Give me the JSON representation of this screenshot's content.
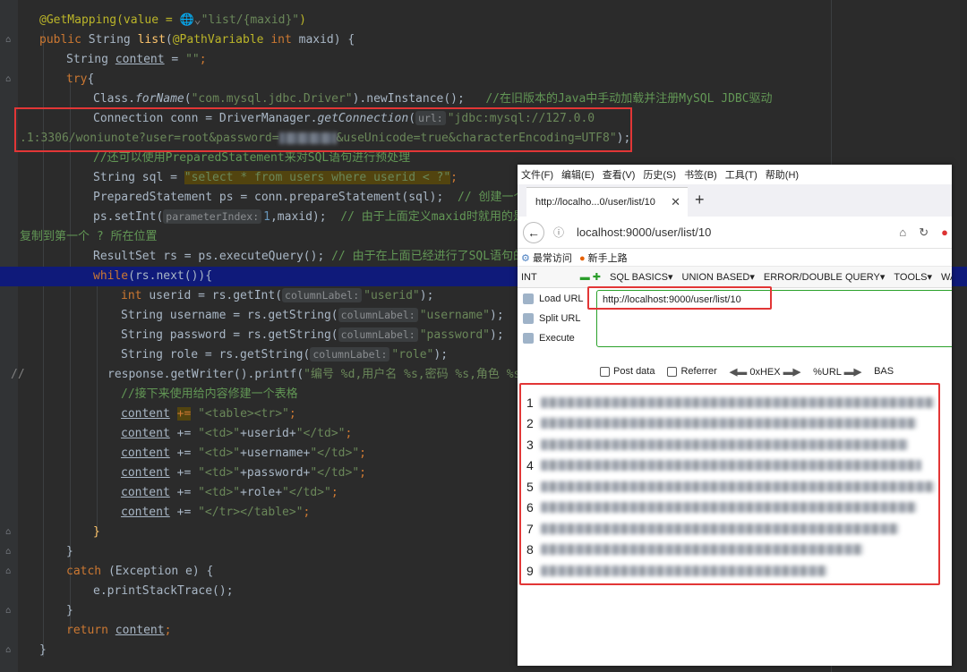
{
  "code": {
    "lines": [
      {
        "t": "ann",
        "text": "@GetMapping(value = ",
        "globe": "🌐",
        "url": "\"list/{maxid}\"",
        "end": ")"
      },
      {
        "t": "method",
        "kw1": "public ",
        "type": "String ",
        "name": "list",
        "p1": "(",
        "ann": "@PathVariable ",
        "kw2": "int ",
        "param": "maxid",
        "p2": ") {"
      },
      {
        "t": "decl",
        "type": "String ",
        "var": "content",
        "eq": " = ",
        "str": "\"\"",
        "end": ";"
      },
      {
        "t": "kw",
        "kw": "try",
        "rest": "{"
      },
      {
        "t": "classload",
        "cls": "Class.",
        "fn": "forName",
        "p1": "(",
        "str": "\"com.mysql.jdbc.Driver\"",
        "p2": ").",
        "fn2": "newInstance",
        "p3": "();   ",
        "cmt": "//在旧版本的Java中手动加载并注册MySQL JDBC驱动"
      },
      {
        "t": "conn1",
        "pre": "Connection conn = DriverManager.",
        "fn": "getConnection",
        "p1": "(",
        "hint": "url:",
        "str": "\"jdbc:mysql://127.0.0"
      },
      {
        "t": "conn2",
        "s1": ".1:3306/woniunote?user=root&password=",
        "s2": "&useUnicode=true&characterEncoding=UTF8\"",
        "end": ");"
      },
      {
        "t": "cmt",
        "cmt": "//还可以使用PreparedStatement来对SQL语句进行预处理"
      },
      {
        "t": "sql",
        "pre": "String sql = ",
        "q": "\"",
        "sqltext": "select * from users where userid < ?",
        "q2": "\"",
        "end": ";"
      },
      {
        "t": "ps",
        "pre": "PreparedStatement ps = conn.prepareStatement(sql);  ",
        "cmt": "// 创建一个可"
      },
      {
        "t": "setint",
        "pre": "ps.setInt(",
        "hint": "parameterIndex:",
        "num": "1",
        "mid": ",maxid);  ",
        "cmt": "// 由于上面定义maxid时就用的是St"
      },
      {
        "t": "wrap",
        "cmt": "复制到第一个 ? 所在位置"
      },
      {
        "t": "rs",
        "pre": "ResultSet rs = ps.executeQuery(); ",
        "cmt": "// 由于在上面已经进行了SQL语句的预"
      },
      {
        "t": "while",
        "kw": "while",
        "rest": "(rs.next()){"
      },
      {
        "t": "get",
        "kw": "int ",
        "pre": "userid = rs.getInt(",
        "hint": "columnLabel:",
        "str": "\"userid\"",
        "end": ");"
      },
      {
        "t": "get",
        "kw": "",
        "pre": "String username = rs.getString(",
        "hint": "columnLabel:",
        "str": "\"username\"",
        "end": ");"
      },
      {
        "t": "get",
        "kw": "",
        "pre": "String password = rs.getString(",
        "hint": "columnLabel:",
        "str": "\"password\"",
        "end": ");"
      },
      {
        "t": "get",
        "kw": "",
        "pre": "String role = rs.getString(",
        "hint": "columnLabel:",
        "str": "\"role\"",
        "end": ");"
      },
      {
        "t": "printf",
        "pre": "response.getWriter().printf(",
        "str": "\"编号 %d,用户名 %s,密码 %s,角色 %s<"
      },
      {
        "t": "cmt2",
        "cmt": "//接下来使用给内容修建一个表格"
      },
      {
        "t": "append",
        "var": "content",
        "op": "+=",
        "sp": " ",
        "str": "\"<table><tr>\"",
        "end": ";"
      },
      {
        "t": "append2",
        "var": "content",
        "op": " += ",
        "s1": "\"<td>\"",
        "mid": "+userid+",
        "s2": "\"</td>\"",
        "end": ";"
      },
      {
        "t": "append2",
        "var": "content",
        "op": " += ",
        "s1": "\"<td>\"",
        "mid": "+username+",
        "s2": "\"</td>\"",
        "end": ";"
      },
      {
        "t": "append2",
        "var": "content",
        "op": " += ",
        "s1": "\"<td>\"",
        "mid": "+password+",
        "s2": "\"</td>\"",
        "end": ";"
      },
      {
        "t": "append2",
        "var": "content",
        "op": " += ",
        "s1": "\"<td>\"",
        "mid": "+role+",
        "s2": "\"</td>\"",
        "end": ";"
      },
      {
        "t": "append3",
        "var": "content",
        "op": " += ",
        "str": "\"</tr></table>\"",
        "end": ";"
      },
      {
        "t": "brace",
        "text": "}"
      },
      {
        "t": "brace",
        "text": "}"
      },
      {
        "t": "catch",
        "kw": "catch",
        "rest": " (Exception e) {"
      },
      {
        "t": "plain",
        "text": "e.printStackTrace();"
      },
      {
        "t": "brace",
        "text": "}"
      },
      {
        "t": "ret",
        "kw": "return ",
        "var": "content",
        "end": ";"
      },
      {
        "t": "brace",
        "text": "}"
      }
    ],
    "comment_marker": "//"
  },
  "browser": {
    "menu": [
      "文件(F)",
      "编辑(E)",
      "查看(V)",
      "历史(S)",
      "书签(B)",
      "工具(T)",
      "帮助(H)"
    ],
    "tab_title": "http://localho...0/user/list/10",
    "tab_close": "✕",
    "new_tab": "+",
    "back": "←",
    "info": "ⓘ",
    "address": "localhost:9000/user/list/10",
    "bookmarks": [
      "最常访问",
      "新手上路"
    ],
    "hackbar": [
      "INT",
      "SQL BASICS▾",
      "UNION BASED▾",
      "ERROR/DOUBLE QUERY▾",
      "TOOLS▾",
      "WAF BY"
    ],
    "load_url": "Load URL",
    "split_url": "Split URL",
    "execute": "Execute",
    "url_value": "http://localhost:9000/user/list/10",
    "opts": [
      "Post data",
      "Referrer",
      "0xHEX",
      "%URL",
      "BAS"
    ],
    "row_numbers": [
      "1",
      "2",
      "3",
      "4",
      "5",
      "6",
      "7",
      "8",
      "9"
    ]
  },
  "colors": {
    "keyword": "#cc7832",
    "string": "#6a8759",
    "annotation": "#bbb529",
    "method": "#ffc66d",
    "field": "#9876aa",
    "comment": "#629755",
    "highlight": "#0f1a7a",
    "redbox": "#e23636"
  }
}
